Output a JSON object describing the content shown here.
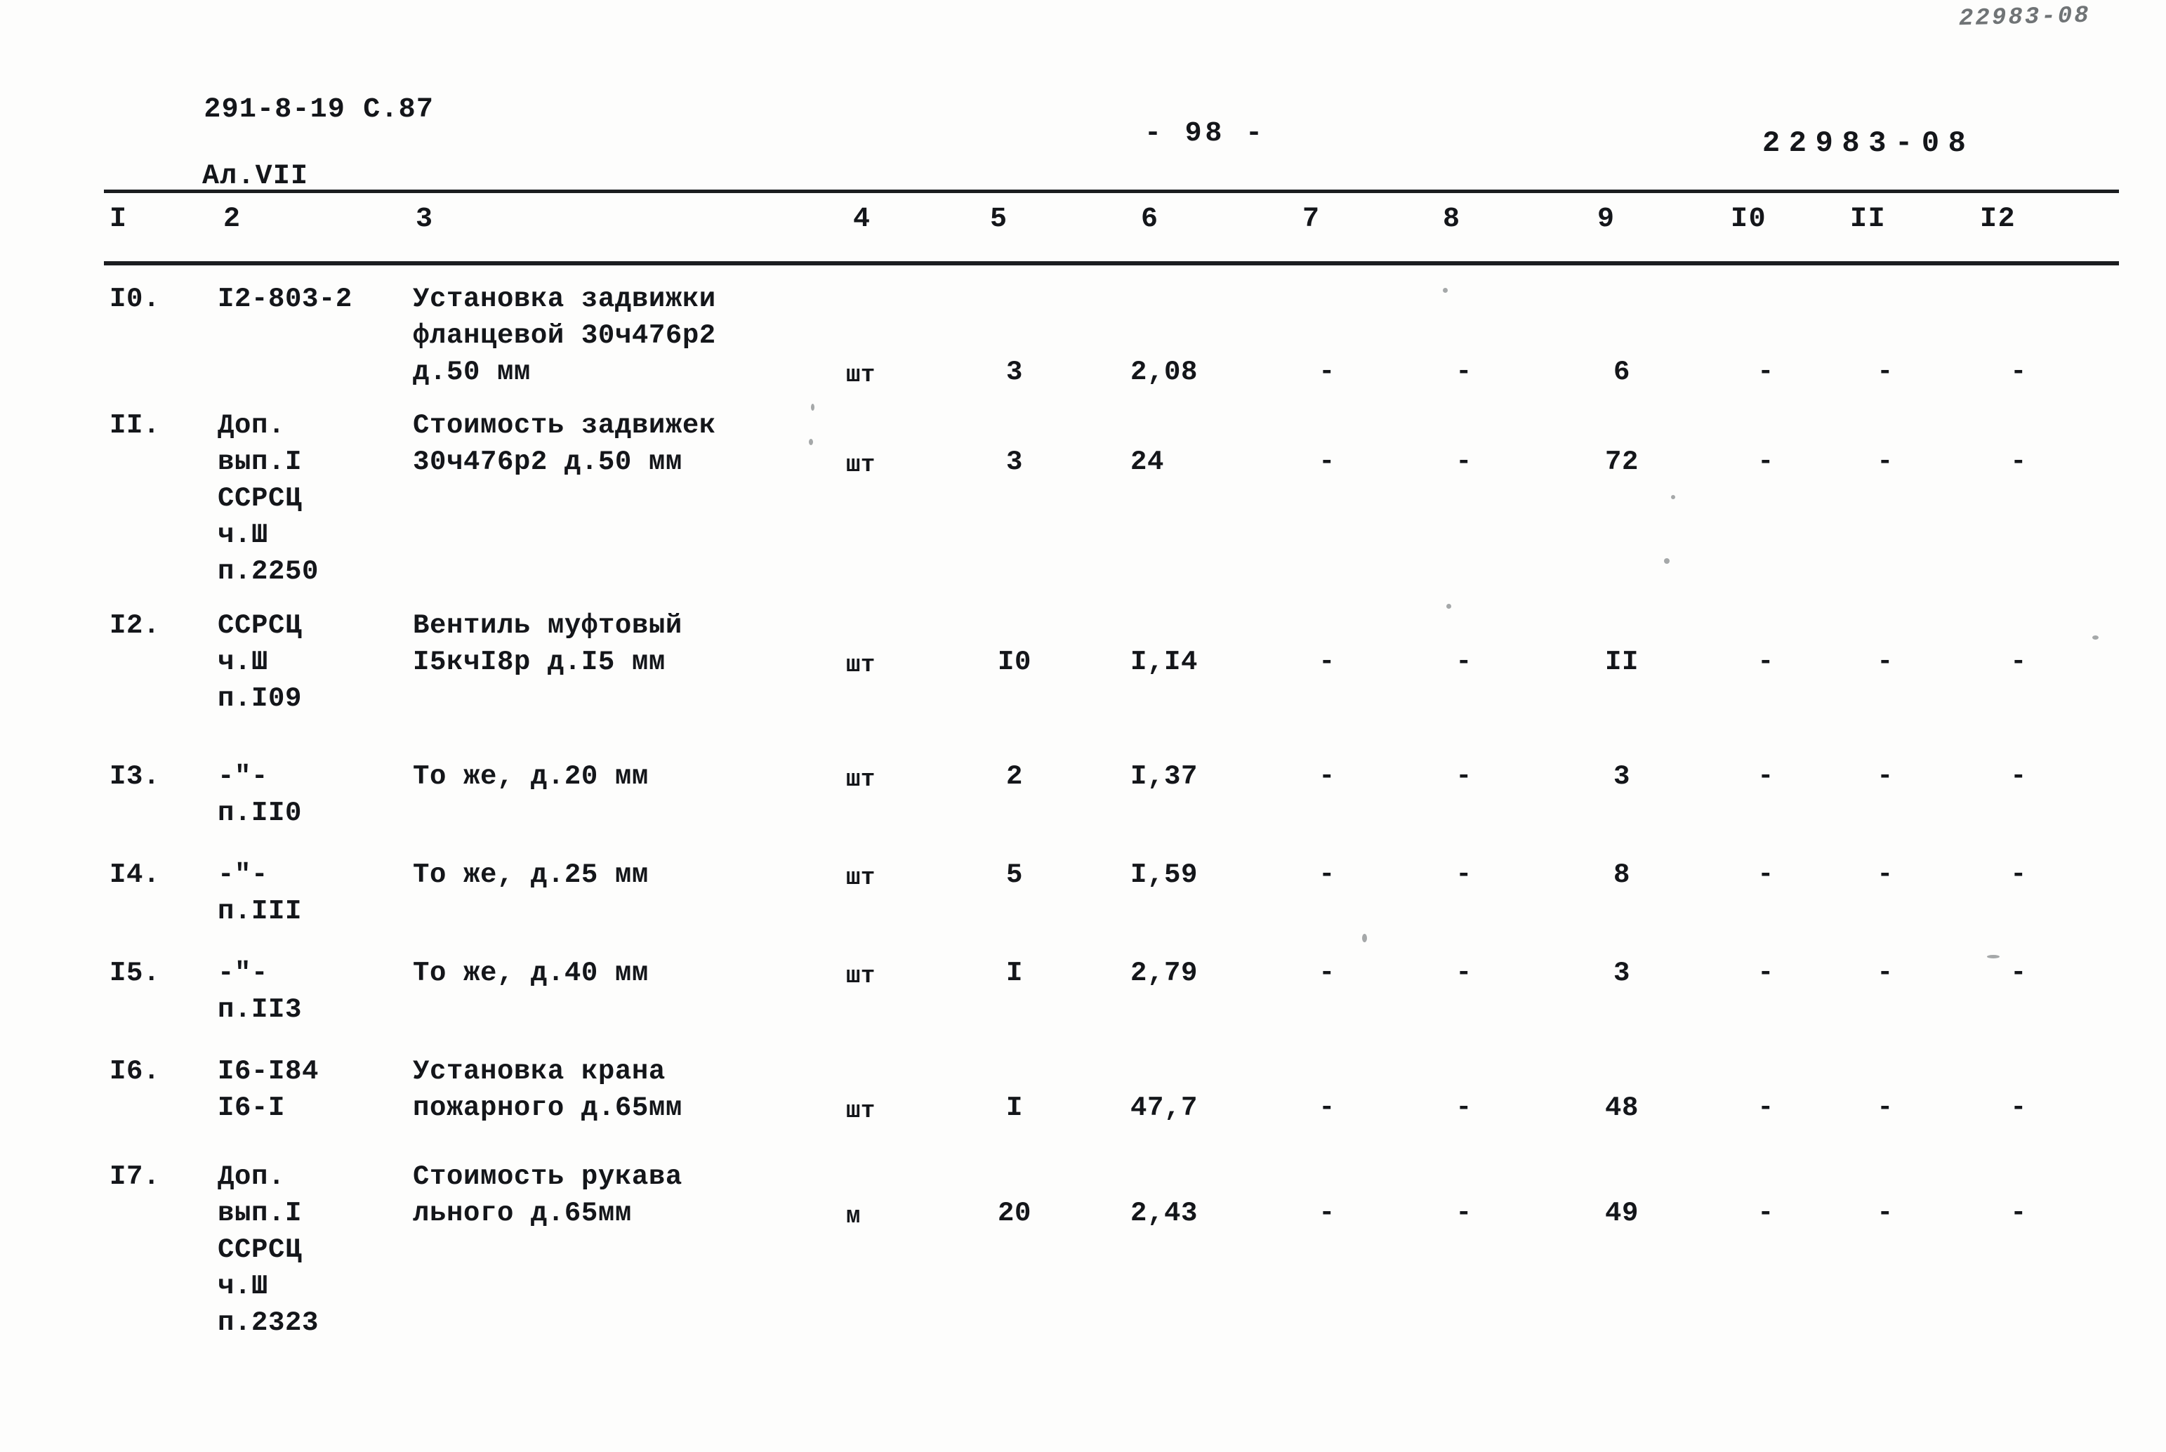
{
  "header": {
    "corner_code": "22983-08",
    "doc_ref_line1": "291-8-19 С.87",
    "doc_ref_line2": "Ал.VII",
    "page_number": "- 98 -",
    "doc_number": "22983-08"
  },
  "table": {
    "column_headers": [
      "I",
      "2",
      "3",
      "4",
      "5",
      "6",
      "7",
      "8",
      "9",
      "I0",
      "II",
      "I2"
    ],
    "rows": [
      {
        "num": "I0.",
        "code": "I2-803-2",
        "desc": "Установка задвижки\nфланцевой 30ч476р2\nд.50 мм",
        "unit": "шт",
        "qty": "3",
        "c6": "2,08",
        "c7": "-",
        "c8": "-",
        "c9": "6",
        "c10": "-",
        "c11": "-",
        "c12": "-"
      },
      {
        "num": "II.",
        "code": "Доп.\nвып.I\nССРСЦ\nч.Ш\nп.2250",
        "desc": "Стоимость задвижек\n30ч476р2 д.50 мм",
        "unit": "шт",
        "qty": "3",
        "c6": "24",
        "c7": "-",
        "c8": "-",
        "c9": "72",
        "c10": "-",
        "c11": "-",
        "c12": "-"
      },
      {
        "num": "I2.",
        "code": "ССРСЦ\nч.Ш\nп.I09",
        "desc": "Вентиль муфтовый\nI5кчI8р д.I5 мм",
        "unit": "шт",
        "qty": "I0",
        "c6": "I,I4",
        "c7": "-",
        "c8": "-",
        "c9": "II",
        "c10": "-",
        "c11": "-",
        "c12": "-"
      },
      {
        "num": "I3.",
        "code": "-\"-\nп.II0",
        "desc": "То же, д.20 мм",
        "unit": "шт",
        "qty": "2",
        "c6": "I,37",
        "c7": "-",
        "c8": "-",
        "c9": "3",
        "c10": "-",
        "c11": "-",
        "c12": "-"
      },
      {
        "num": "I4.",
        "code": "-\"-\nп.III",
        "desc": "То же, д.25 мм",
        "unit": "шт",
        "qty": "5",
        "c6": "I,59",
        "c7": "-",
        "c8": "-",
        "c9": "8",
        "c10": "-",
        "c11": "-",
        "c12": "-"
      },
      {
        "num": "I5.",
        "code": "-\"-\nп.II3",
        "desc": "То же, д.40 мм",
        "unit": "шт",
        "qty": "I",
        "c6": "2,79",
        "c7": "-",
        "c8": "-",
        "c9": "3",
        "c10": "-",
        "c11": "-",
        "c12": "-"
      },
      {
        "num": "I6.",
        "code": "I6-I84\nI6-I",
        "desc": "Установка крана\nпожарного д.65мм",
        "unit": "шт",
        "qty": "I",
        "c6": "47,7",
        "c7": "-",
        "c8": "-",
        "c9": "48",
        "c10": "-",
        "c11": "-",
        "c12": "-"
      },
      {
        "num": "I7.",
        "code": "Доп.\nвып.I\nССРСЦ\nч.Ш\nп.2323",
        "desc": "Стоимость рукава\nльного д.65мм",
        "unit": "м",
        "qty": "20",
        "c6": "2,43",
        "c7": "-",
        "c8": "-",
        "c9": "49",
        "c10": "-",
        "c11": "-",
        "c12": "-"
      }
    ]
  }
}
